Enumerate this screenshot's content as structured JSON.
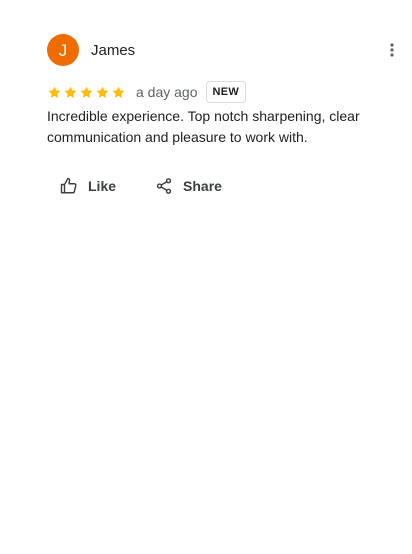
{
  "review": {
    "avatar_letter": "J",
    "avatar_color": "#ef6c00",
    "reviewer_name": "James",
    "rating": 5,
    "rating_max": 5,
    "star_color": "#fbbc04",
    "time": "a day ago",
    "badge": "NEW",
    "text": "Incredible experience. Top notch sharpening, clear communication and pleasure to work with.",
    "more_icon": "more-vert-icon"
  },
  "actions": {
    "like_label": "Like",
    "like_icon": "thumb-up-icon",
    "share_label": "Share",
    "share_icon": "share-icon"
  }
}
